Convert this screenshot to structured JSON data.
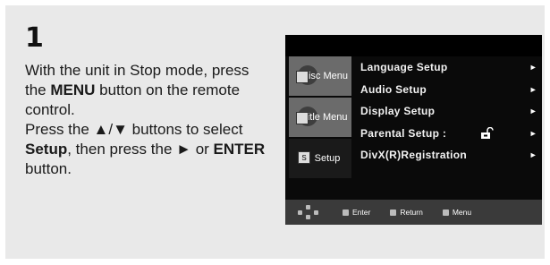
{
  "step": {
    "number": "1"
  },
  "instructions": {
    "p1_a": "With the unit in Stop mode, press the ",
    "p1_b": "MENU",
    "p1_c": " button on the remote control.",
    "p2_a": "Press the ▲/▼ buttons to select ",
    "p2_b": "Setup",
    "p2_c": ", then press the ► or ",
    "p2_d": "ENTER",
    "p2_e": " button."
  },
  "osd": {
    "sidebar": [
      {
        "label": "Disc Menu",
        "active": false
      },
      {
        "label": "Title Menu",
        "active": false
      },
      {
        "label": "Setup",
        "active": true
      }
    ],
    "menu_items": [
      {
        "label": "Language Setup",
        "arrow": "►"
      },
      {
        "label": "Audio Setup",
        "arrow": "►"
      },
      {
        "label": "Display Setup",
        "arrow": "►"
      },
      {
        "label": "Parental Setup :",
        "arrow": "►"
      },
      {
        "label": "DivX(R)Registration",
        "arrow": "►"
      }
    ],
    "bottom_bar": {
      "enter": "Enter",
      "return": "Return",
      "menu": "Menu"
    },
    "colors": {
      "screen_bg": "#0a0a0a",
      "tab_inactive": "#6b6b6b",
      "tab_active": "#1a1a1a",
      "bottom_bar": "#3a3a3a"
    }
  }
}
